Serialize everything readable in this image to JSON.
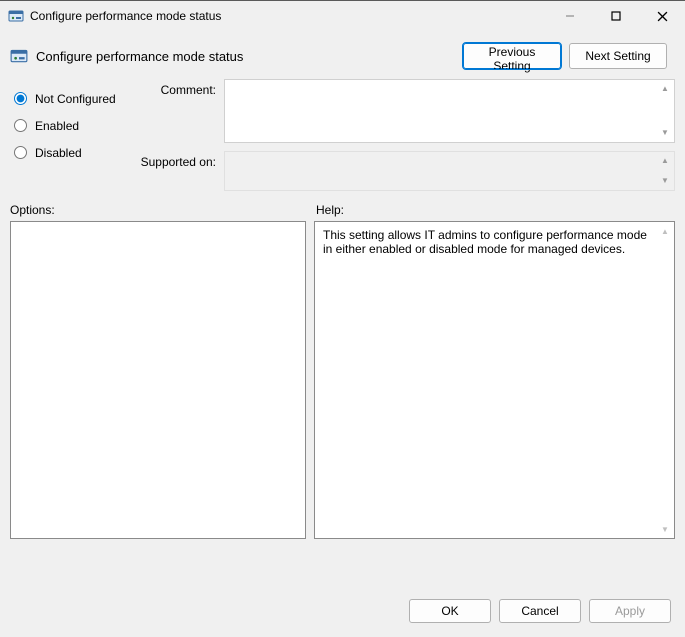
{
  "window": {
    "title": "Configure performance mode status"
  },
  "header": {
    "title": "Configure performance mode status",
    "nav": {
      "previous": "Previous Setting",
      "next": "Next Setting"
    }
  },
  "settings": {
    "radios": {
      "not_configured": "Not Configured",
      "enabled": "Enabled",
      "disabled": "Disabled",
      "selected": "not_configured"
    },
    "comment_label": "Comment:",
    "comment_value": "",
    "supported_label": "Supported on:",
    "supported_value": ""
  },
  "panes": {
    "options_label": "Options:",
    "help_label": "Help:",
    "help_text": "This setting allows IT admins to configure performance mode in either enabled or disabled mode for managed devices."
  },
  "footer": {
    "ok": "OK",
    "cancel": "Cancel",
    "apply": "Apply"
  }
}
